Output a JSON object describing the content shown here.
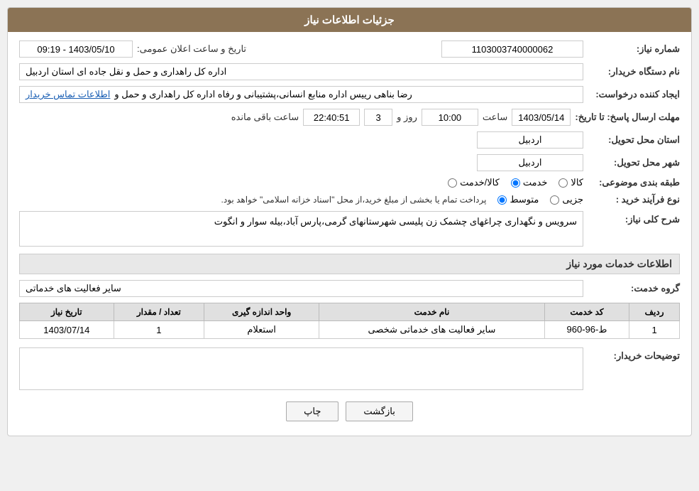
{
  "header": {
    "title": "جزئیات اطلاعات نیاز"
  },
  "fields": {
    "niaz_number_label": "شماره نیاز:",
    "niaz_number_value": "1103003740000062",
    "buyer_org_label": "نام دستگاه خریدار:",
    "buyer_org_value": "اداره کل راهداری و حمل و نقل جاده ای استان اردبیل",
    "creator_label": "ایجاد کننده درخواست:",
    "creator_value": "رضا بناهی رییس اداره منابع انسانی،پشتیبانی و رفاه اداره کل راهداری و حمل و",
    "creator_link": "اطلاعات تماس خریدار",
    "deadline_label": "مهلت ارسال پاسخ: تا تاریخ:",
    "deadline_date": "1403/05/14",
    "deadline_time_label": "ساعت",
    "deadline_time": "10:00",
    "deadline_days_label": "روز و",
    "deadline_days": "3",
    "deadline_remaining_label": "ساعت باقی مانده",
    "deadline_remaining": "22:40:51",
    "province_label": "استان محل تحویل:",
    "province_value": "اردبیل",
    "city_label": "شهر محل تحویل:",
    "city_value": "اردبیل",
    "category_label": "طبقه بندی موضوعی:",
    "category_options": [
      {
        "id": "kala",
        "label": "کالا",
        "checked": false
      },
      {
        "id": "khedmat",
        "label": "خدمت",
        "checked": true
      },
      {
        "id": "kala_khedmat",
        "label": "کالا/خدمت",
        "checked": false
      }
    ],
    "purchase_type_label": "نوع فرآیند خرید :",
    "purchase_type_options": [
      {
        "id": "jozi",
        "label": "جزیی",
        "checked": false
      },
      {
        "id": "motavasset",
        "label": "متوسط",
        "checked": true
      }
    ],
    "purchase_note": "پرداخت تمام یا بخشی از مبلغ خرید،از محل \"اسناد خزانه اسلامی\" خواهد بود.",
    "description_label": "شرح کلی نیاز:",
    "description_value": "سرویس و نگهداری چراغهای چشمک زن پلیسی شهرستانهای گرمی،پارس آباد،بیله سوار و انگوت",
    "services_section_label": "اطلاعات خدمات مورد نیاز",
    "service_group_label": "گروه خدمت:",
    "service_group_value": "سایر فعالیت های خدماتی",
    "table_headers": [
      "ردیف",
      "کد خدمت",
      "نام خدمت",
      "واحد اندازه گیری",
      "تعداد / مقدار",
      "تاریخ نیاز"
    ],
    "table_rows": [
      {
        "row": "1",
        "code": "ط-96-960",
        "name": "سایر فعالیت های خدماتی شخصی",
        "unit": "استعلام",
        "quantity": "1",
        "date": "1403/07/14"
      }
    ],
    "buyer_desc_label": "توضیحات خریدار:",
    "buyer_desc_value": "",
    "btn_back": "بازگشت",
    "btn_print": "چاپ",
    "date_range_label": "تاریخ و ساعت اعلان عمومی:",
    "date_range_value": "1403/05/10 - 09:19"
  }
}
